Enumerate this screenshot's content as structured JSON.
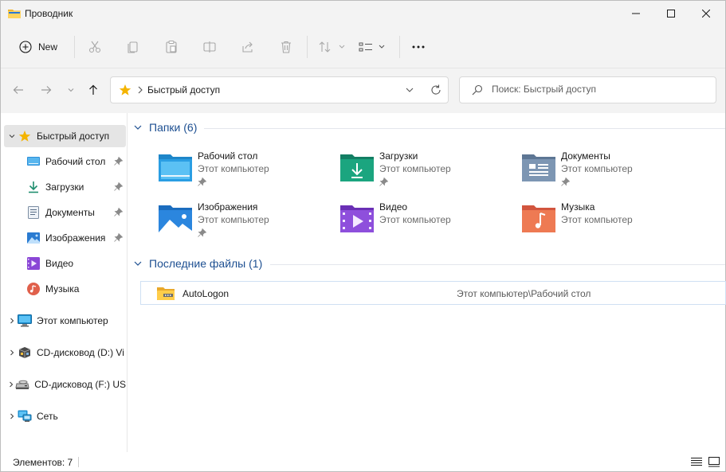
{
  "window": {
    "title": "Проводник",
    "minimize_icon": "minimize-icon",
    "maximize_icon": "maximize-icon",
    "close_icon": "close-icon"
  },
  "toolbar": {
    "new_label": "New",
    "buttons": [
      "cut-icon",
      "copy-icon",
      "paste-icon",
      "rename-icon",
      "share-icon",
      "delete-icon",
      "sort-icon",
      "view-icon",
      "more-icon"
    ]
  },
  "address": {
    "path": "Быстрый доступ",
    "icon": "star-icon"
  },
  "search": {
    "placeholder": "Поиск: Быстрый доступ"
  },
  "sidebar": {
    "items": [
      {
        "label": "Быстрый доступ",
        "icon": "star-icon",
        "selected": true
      },
      {
        "label": "Рабочий стол",
        "icon": "desktop-icon",
        "pinned": true
      },
      {
        "label": "Загрузки",
        "icon": "download-icon",
        "pinned": true
      },
      {
        "label": "Документы",
        "icon": "document-icon",
        "pinned": true
      },
      {
        "label": "Изображения",
        "icon": "pictures-icon",
        "pinned": true
      },
      {
        "label": "Видео",
        "icon": "video-icon"
      },
      {
        "label": "Музыка",
        "icon": "music-icon"
      },
      {
        "label": "Этот компьютер",
        "icon": "computer-icon"
      },
      {
        "label": "CD-дисковод (D:) Vi",
        "icon": "cd-drive-icon"
      },
      {
        "label": "CD-дисковод (F:) US",
        "icon": "cd-drive-icon"
      },
      {
        "label": "Сеть",
        "icon": "network-icon"
      }
    ]
  },
  "folders": {
    "header": "Папки (6)",
    "items": [
      {
        "name": "Рабочий стол",
        "sub": "Этот компьютер",
        "pinned": true,
        "icon": "desktop-folder-icon"
      },
      {
        "name": "Загрузки",
        "sub": "Этот компьютер",
        "pinned": true,
        "icon": "downloads-folder-icon"
      },
      {
        "name": "Документы",
        "sub": "Этот компьютер",
        "pinned": true,
        "icon": "documents-folder-icon"
      },
      {
        "name": "Изображения",
        "sub": "Этот компьютер",
        "pinned": true,
        "icon": "pictures-folder-icon"
      },
      {
        "name": "Видео",
        "sub": "Этот компьютер",
        "pinned": false,
        "icon": "video-folder-icon"
      },
      {
        "name": "Музыка",
        "sub": "Этот компьютер",
        "pinned": false,
        "icon": "music-folder-icon"
      }
    ]
  },
  "recent": {
    "header": "Последние файлы (1)",
    "items": [
      {
        "name": "AutoLogon",
        "location": "Этот компьютер\\Рабочий стол",
        "icon": "zip-folder-icon"
      }
    ]
  },
  "status": {
    "count": "Элементов: 7"
  },
  "colors": {
    "accent": "#1d4f91",
    "chrome": "#f3f3f3",
    "selected": "#e5e5e5",
    "star": "#f4b400"
  }
}
